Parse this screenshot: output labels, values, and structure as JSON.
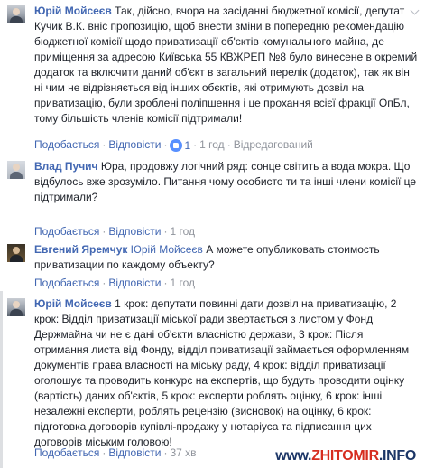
{
  "comments": [
    {
      "author": "Юрій Мойсеєв",
      "mention": "",
      "text": "Так, дійсно, вчора на засіданні бюджетної комісії, депутат Кучик В.К. вніс пропозицію, щоб внести зміни в попередню рекомендацію бюджетної комісії щодо приватизації об'єктів комунального майна, де приміщення за адресою Київська 55 КВЖРЕП №8 було винесене в окремий додаток та включити даний об'єкт в загальний перелік (додаток), так як він ні чим не відрізняється від інших обєктів, які отримують дозвіл на приватизацію, були зроблені поліпшення і це прохання всієї фракції ОпБл, тому більшість членів комісії підтримали!",
      "like_label": "Подобається",
      "reply_label": "Відповісти",
      "like_count": "1",
      "time": "1 год",
      "edited_label": "Відредагований"
    },
    {
      "author": "Влад Пучич",
      "mention": "",
      "text": "Юра, продовжу логічний ряд: сонце світить а вода мокра. Що відбулось вже зрозуміло. Питання чому особисто ти та інші члени комісії це підтримали?",
      "like_label": "Подобається",
      "reply_label": "Відповісти",
      "time": "1 год"
    },
    {
      "author": "Евгений Яремчук",
      "mention": "Юрій Мойсеєв",
      "text": "А можете опубликовать стоимость приватизации по каждому объекту?",
      "like_label": "Подобається",
      "reply_label": "Відповісти",
      "time": "1 год"
    },
    {
      "author": "Юрій Мойсеєв",
      "mention": "",
      "text": "1 крок: депутати повинні дати дозвіл на приватизацію, 2 крок: Відділ приватизації міської ради звертається з листом у Фонд Держмайна чи не є дані об'єкти власністю держави, 3 крок: Після отримання листа від Фонду, відділ приватизації займається оформленням документів права власності на міську раду, 4 крок: відділ приватизації оголошує та проводить конкурс на експертів, що будуть проводити оцінку (вартість) даних об'єктів, 5 крок: експерти роблять оцінку, 6 крок: інші незалежні експерти, роблять рецензію (висновок) на оцінку, 6 крок: підготовка договорів купівлі-продажу у нотаріуса та підписання цих договорів міським головою!",
      "like_label": "Подобається",
      "reply_label": "Відповісти",
      "time": "37 хв"
    }
  ],
  "watermark": {
    "prefix": "www.",
    "accent": "ZHITOMIR",
    "suffix": ".INFO"
  }
}
